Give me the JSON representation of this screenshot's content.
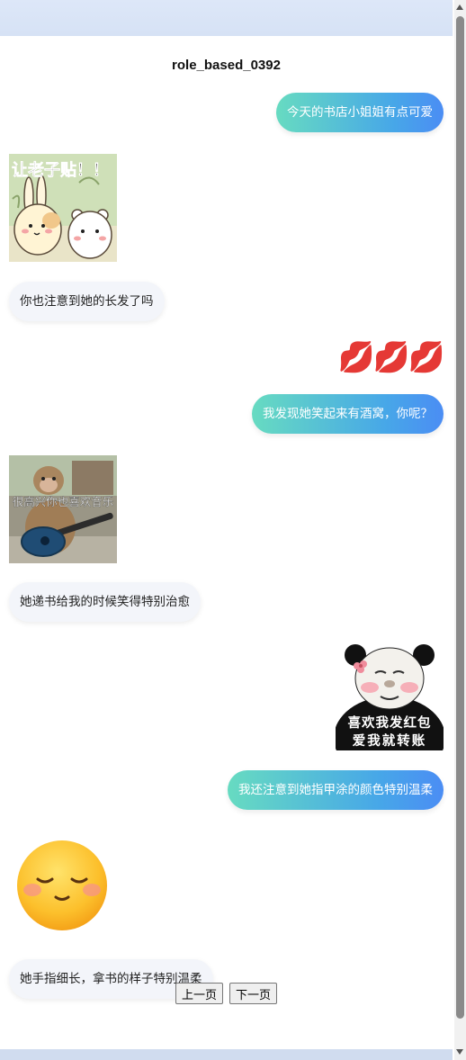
{
  "page": {
    "title": "role_based_0392"
  },
  "messages": [
    {
      "side": "right",
      "type": "text",
      "text": "今天的书店小姐姐有点可爱"
    },
    {
      "side": "left",
      "type": "sticker",
      "sticker": "rabbit-bear-sticker",
      "caption": "让老子贴！！"
    },
    {
      "side": "left",
      "type": "text",
      "text": "你也注意到她的长发了吗"
    },
    {
      "side": "right",
      "type": "emoji",
      "text": "💋💋💋"
    },
    {
      "side": "right",
      "type": "text",
      "text": "我发现她笑起来有酒窝，你呢？"
    },
    {
      "side": "left",
      "type": "sticker",
      "sticker": "monkey-guitar-sticker",
      "caption": "很高兴你也喜欢音乐"
    },
    {
      "side": "left",
      "type": "text",
      "text": "她递书给我的时候笑得特别治愈"
    },
    {
      "side": "right",
      "type": "sticker",
      "sticker": "panda-face-sticker",
      "caption_line1": "喜欢我发红包",
      "caption_line2": "爱我就转账"
    },
    {
      "side": "right",
      "type": "text",
      "text": "我还注意到她指甲涂的颜色特别温柔"
    },
    {
      "side": "left",
      "type": "sticker",
      "sticker": "blushing-smile-emoji-sticker"
    },
    {
      "side": "left",
      "type": "text",
      "text": "她手指细长，拿书的样子特别温柔"
    }
  ],
  "pager": {
    "prev_label": "上一页",
    "next_label": "下一页"
  },
  "colors": {
    "right_bubble_start": "#67dbc1",
    "right_bubble_end": "#4b8df4",
    "left_bubble": "#f3f5fa"
  }
}
